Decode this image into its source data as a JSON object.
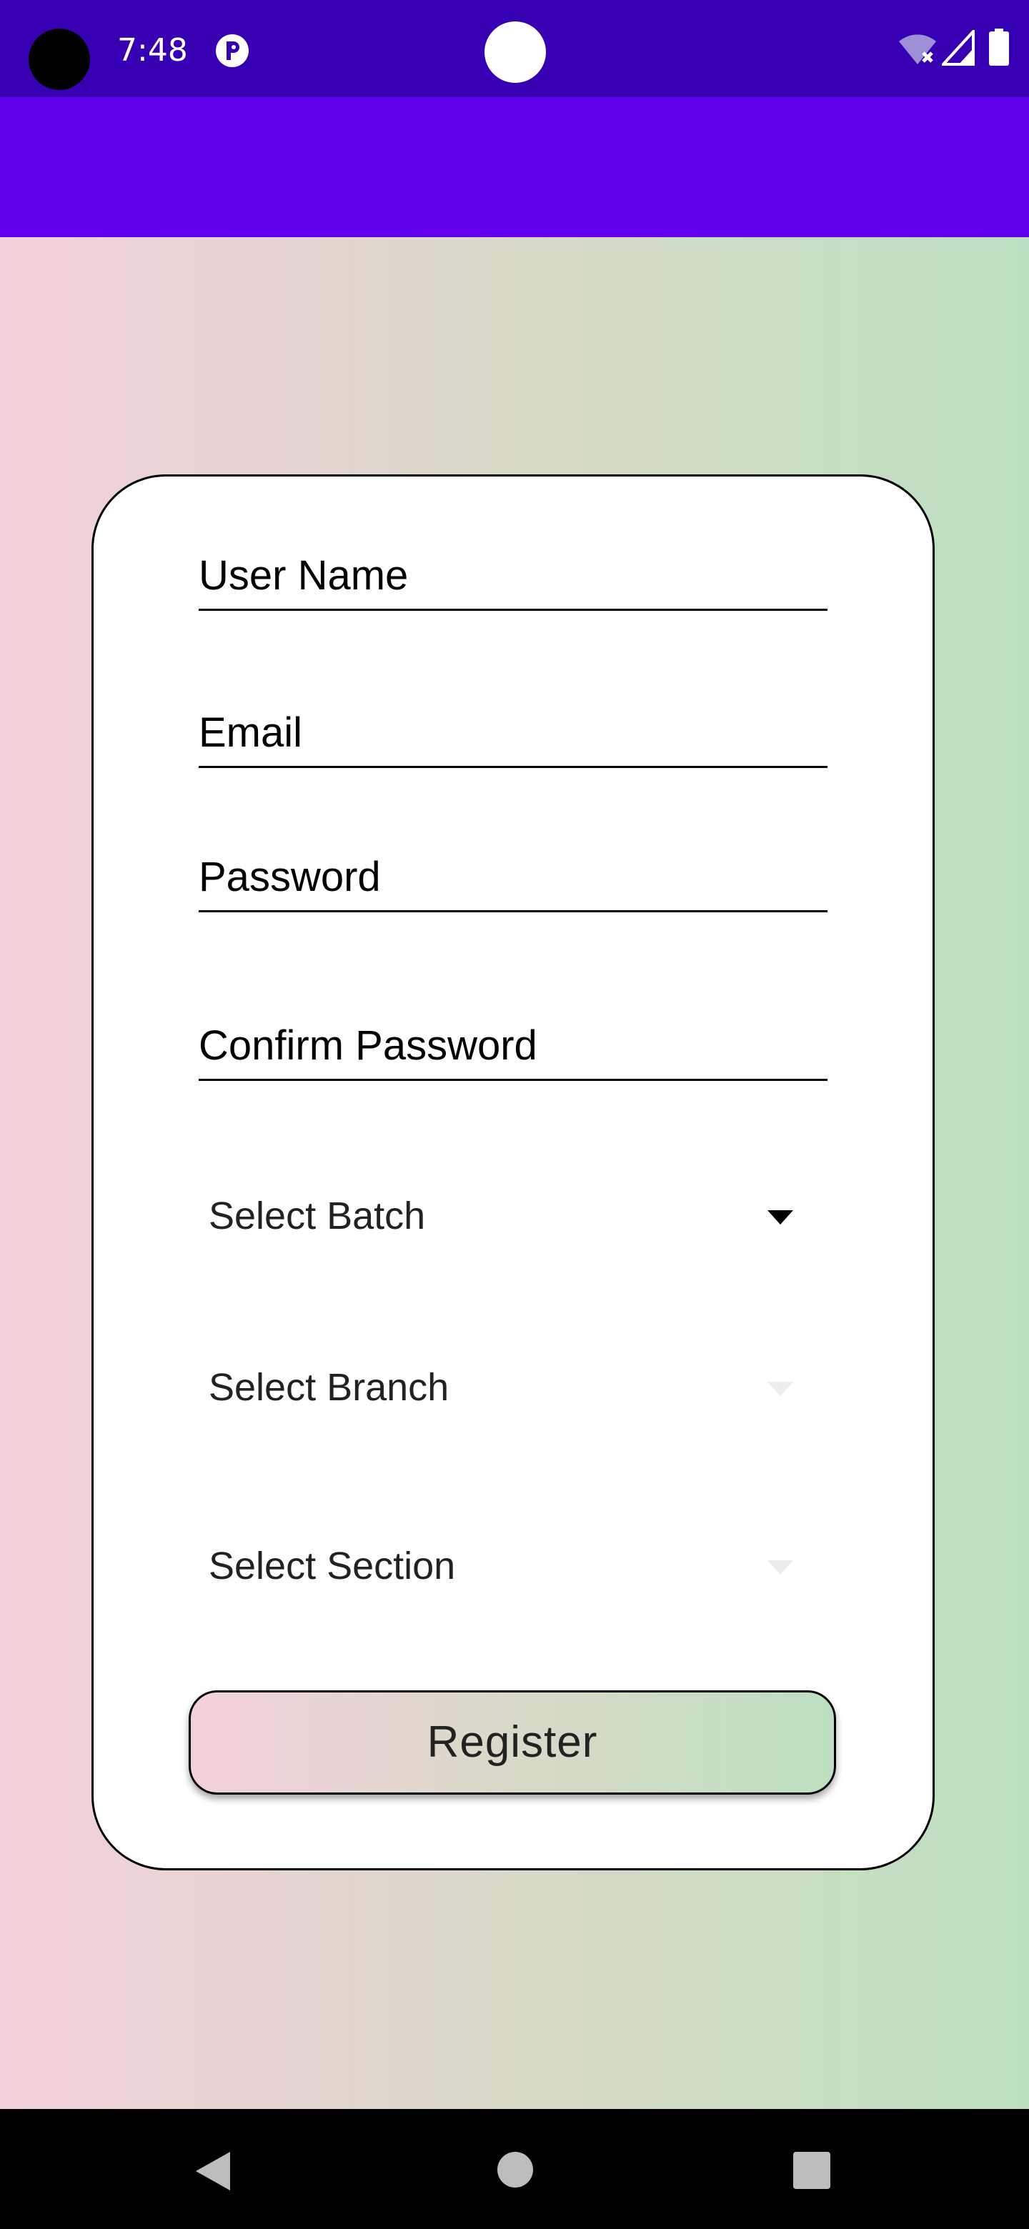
{
  "status_bar": {
    "time": "7:48",
    "icons": [
      "camera-dot",
      "app-notification-icon",
      "wifi-off-icon",
      "signal-icon",
      "battery-icon"
    ]
  },
  "colors": {
    "status_bar": "#3700b3",
    "app_bar": "#6200ee",
    "gradient_start": "#f3d1da",
    "gradient_end": "#bce0bf"
  },
  "form": {
    "username_label": "User Name",
    "email_label": "Email",
    "password_label": "Password",
    "confirm_password_label": "Confirm Password",
    "batch_label": "Select Batch",
    "branch_label": "Select Branch",
    "section_label": "Select Section",
    "register_label": "Register"
  },
  "nav_bar": {
    "icons": [
      "back-icon",
      "home-icon",
      "recents-icon"
    ]
  }
}
